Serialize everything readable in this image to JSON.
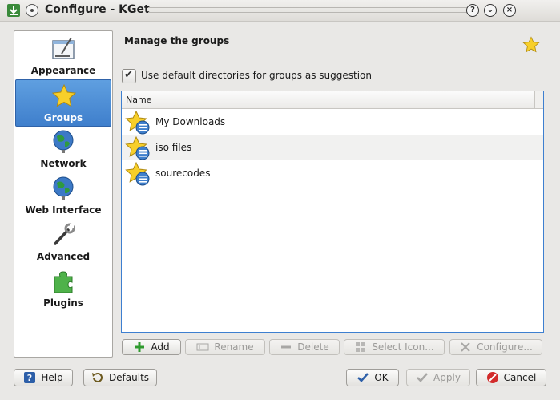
{
  "window": {
    "title": "Configure - KGet",
    "buttons": {
      "help": "?",
      "minimize": "⌄",
      "close": "×"
    }
  },
  "sidebar": {
    "items": [
      {
        "label": "Appearance",
        "icon": "appearance-icon"
      },
      {
        "label": "Groups",
        "icon": "star-icon",
        "active": true
      },
      {
        "label": "Network",
        "icon": "globe-network-icon"
      },
      {
        "label": "Web Interface",
        "icon": "globe-web-icon"
      },
      {
        "label": "Advanced",
        "icon": "wrench-icon"
      },
      {
        "label": "Plugins",
        "icon": "puzzle-icon"
      }
    ]
  },
  "page": {
    "title": "Manage the groups",
    "checkbox_label": "Use default directories for groups as suggestion",
    "checkbox_checked": true
  },
  "list": {
    "column_header": "Name",
    "rows": [
      "My Downloads",
      "iso files",
      "sourecodes"
    ]
  },
  "actions": {
    "add": "Add",
    "rename": "Rename",
    "delete": "Delete",
    "select_icon": "Select Icon...",
    "configure": "Configure..."
  },
  "footer": {
    "help": "Help",
    "defaults": "Defaults",
    "ok": "OK",
    "apply": "Apply",
    "cancel": "Cancel"
  },
  "colors": {
    "selection": "#4a8ad4",
    "list_border": "#3d7fd0",
    "star": "#f5c518"
  }
}
